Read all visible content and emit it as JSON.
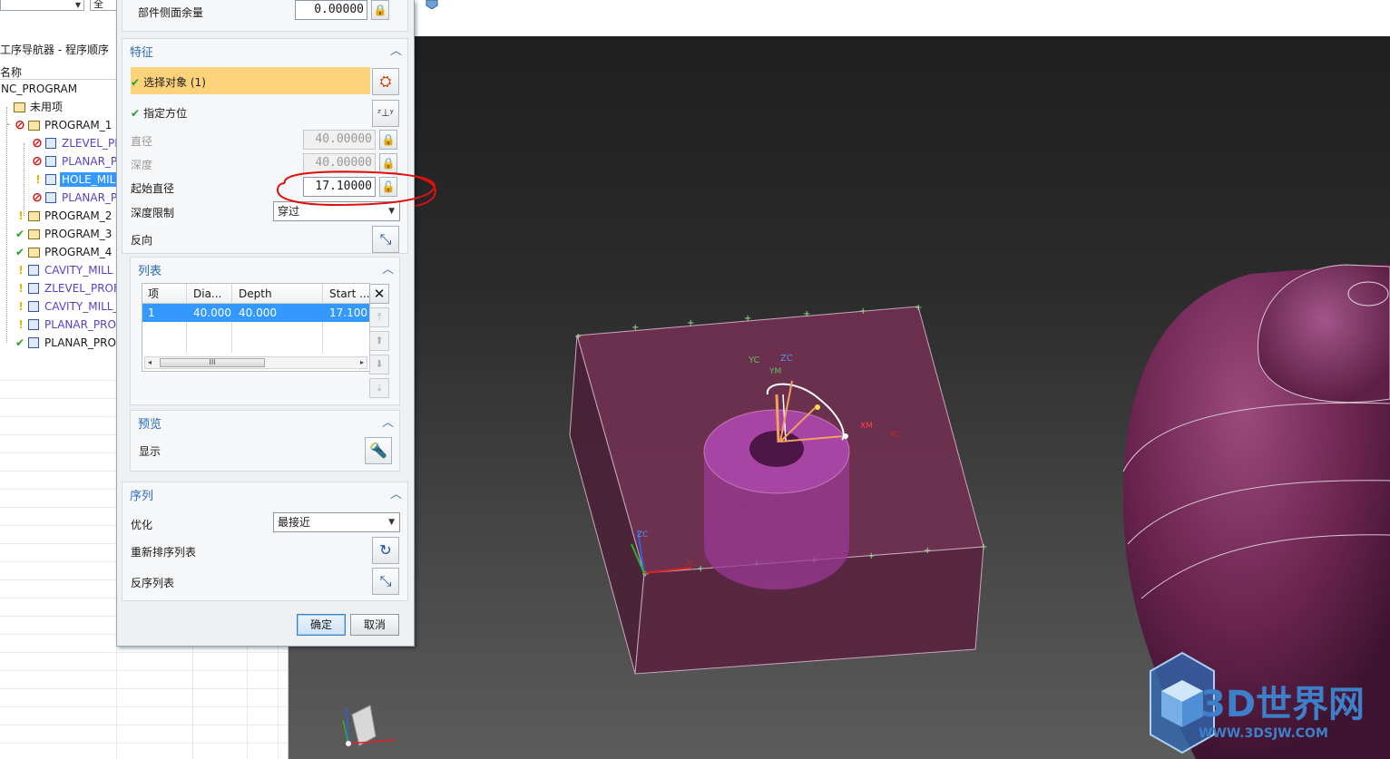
{
  "topbar": {
    "combo1_value": "",
    "combo2_value": "全"
  },
  "navigator": {
    "title": "工序导航器 - 程序顺序",
    "column_name": "名称",
    "items": [
      {
        "label": "NC_PROGRAM",
        "status": "",
        "kind": "root"
      },
      {
        "label": "未用项",
        "status": "",
        "kind": "folder"
      },
      {
        "label": "PROGRAM_1",
        "status": "no",
        "kind": "folder"
      },
      {
        "label": "ZLEVEL_PR",
        "status": "no",
        "kind": "op"
      },
      {
        "label": "PLANAR_P",
        "status": "no",
        "kind": "op"
      },
      {
        "label": "HOLE_MIL",
        "status": "warn",
        "kind": "op"
      },
      {
        "label": "PLANAR_P",
        "status": "no",
        "kind": "op"
      },
      {
        "label": "PROGRAM_2",
        "status": "warn",
        "kind": "folder"
      },
      {
        "label": "PROGRAM_3",
        "status": "ok",
        "kind": "folder"
      },
      {
        "label": "PROGRAM_4",
        "status": "ok",
        "kind": "folder"
      },
      {
        "label": "CAVITY_MILL",
        "status": "warn",
        "kind": "op"
      },
      {
        "label": "ZLEVEL_PROFI",
        "status": "warn",
        "kind": "op"
      },
      {
        "label": "CAVITY_MILL_",
        "status": "warn",
        "kind": "op"
      },
      {
        "label": "PLANAR_PROI",
        "status": "warn",
        "kind": "op"
      },
      {
        "label": "PLANAR_PROI",
        "status": "ok",
        "kind": "op"
      }
    ]
  },
  "dialog": {
    "stock_label": "部件侧面余量",
    "stock_value": "0.00000",
    "feature": {
      "header": "特征",
      "select_object": "选择对象 (1)",
      "specify_orientation": "指定方位",
      "diameter_label": "直径",
      "diameter_value": "40.00000",
      "depth_label": "深度",
      "depth_value": "40.00000",
      "start_diameter_label": "起始直径",
      "start_diameter_value": "17.10000",
      "depth_limit_label": "深度限制",
      "depth_limit_value": "穿过",
      "reverse_label": "反向"
    },
    "list": {
      "header": "列表",
      "columns": [
        "项",
        "Dia...",
        "Depth",
        "Start ..."
      ],
      "rows": [
        [
          "1",
          "40.000",
          "40.000",
          "17.100"
        ]
      ],
      "scroll_thumb": "III"
    },
    "preview": {
      "header": "预览",
      "display_label": "显示"
    },
    "sequence": {
      "header": "序列",
      "optimize_label": "优化",
      "optimize_value": "最接近",
      "reorder_label": "重新排序列表",
      "reverse_list_label": "反序列表"
    },
    "ok_label": "确定",
    "cancel_label": "取消"
  },
  "viewport": {
    "axis_labels": {
      "yc": "YC",
      "zc": "ZC",
      "xc": "XC",
      "xm": "XM",
      "ym": "YM",
      "zm": "ZM"
    },
    "watermark_title": "3D世界网",
    "watermark_url": "WWW.3DSJW.COM",
    "colors": {
      "part": "#7a2b5c",
      "hole": "#a63ea0",
      "annotation": "#e01010",
      "watermark": "#3d7fc8"
    }
  }
}
